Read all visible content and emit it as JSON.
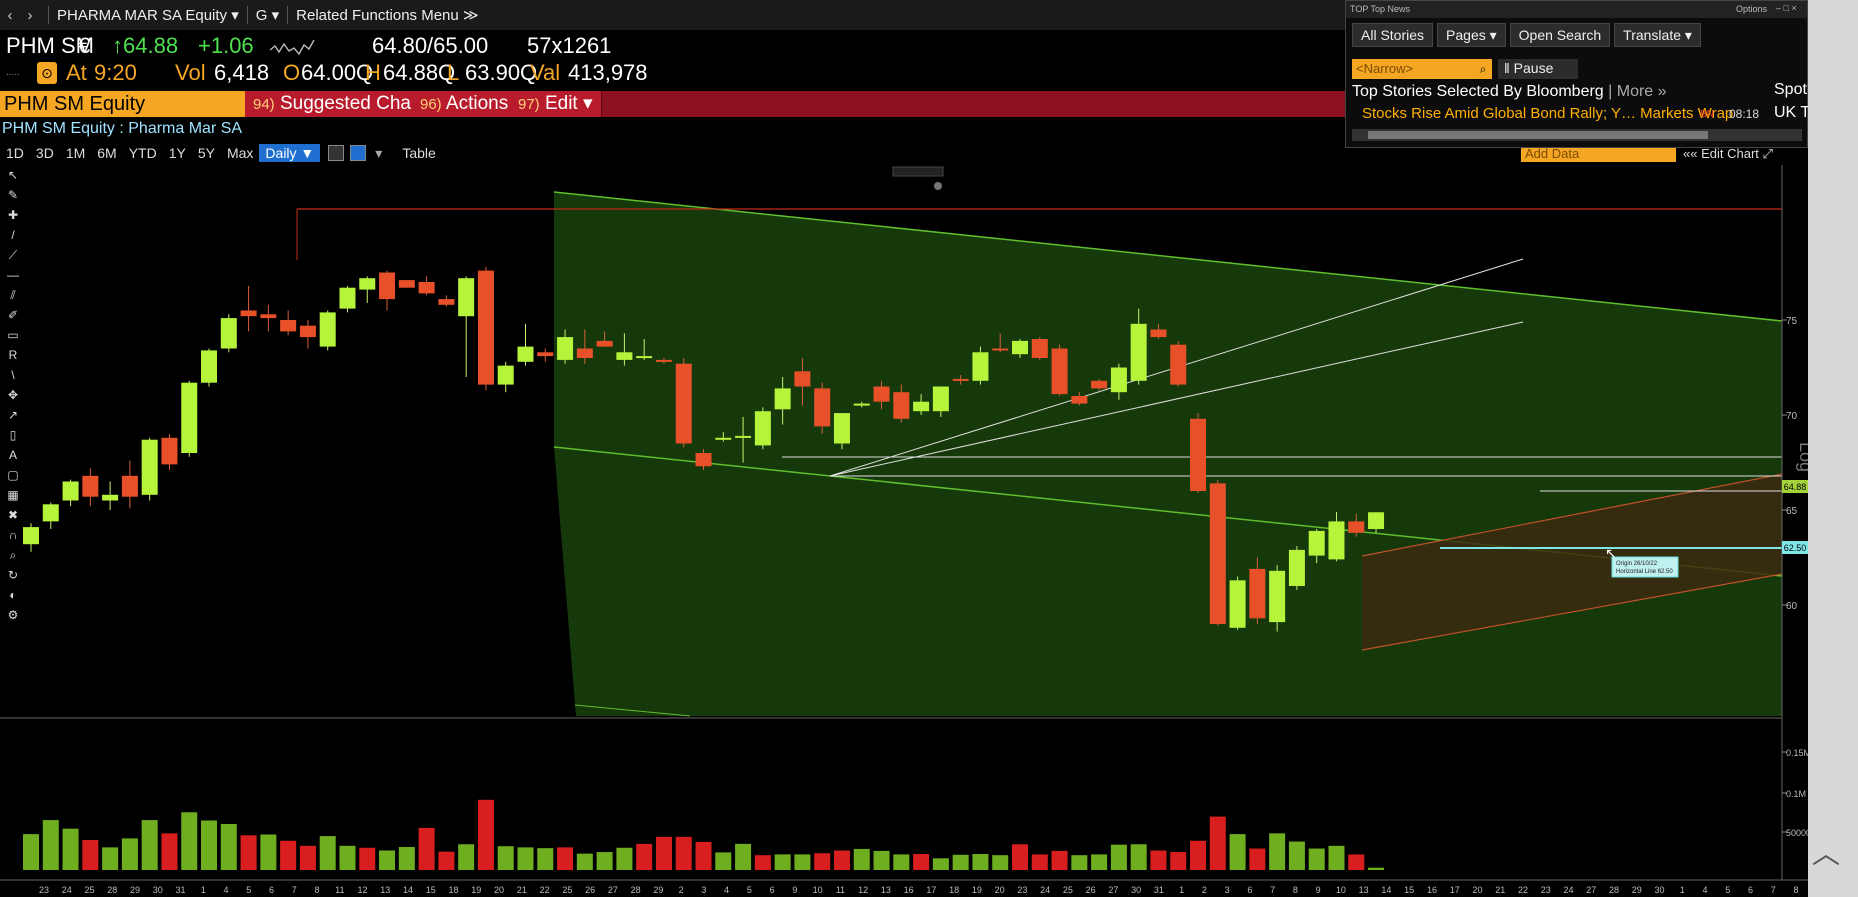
{
  "menu": {
    "back": "‹",
    "forward": "›",
    "security": "PHARMA MAR SA Equity ▾",
    "g": "G ▾",
    "related": "Related Functions Menu ≫"
  },
  "quote": {
    "ticker": "PHM SM",
    "currency": "€",
    "last": "↑64.88",
    "change": "+1.06",
    "bidask": "64.80/65.00",
    "size": "57x1261",
    "at_label": "At",
    "time": "9:20",
    "vol_label": "Vol",
    "vol": "6,418",
    "open_label": "O",
    "open": "64.00Q",
    "high_label": "H",
    "high": "64.88Q",
    "low_label": "L",
    "low": "63.90Q",
    "val_label": "Val",
    "val": "413,978"
  },
  "commandbar": {
    "ticker": "PHM SM Equity",
    "suggested_num": "94)",
    "suggested": "Suggested Charts ▾",
    "actions_num": "96)",
    "actions": "Actions ▾",
    "edit_num": "97)",
    "edit": "Edit ▾"
  },
  "subtitle": "PHM SM Equity : Pharma Mar SA",
  "periods": [
    "1D",
    "3D",
    "1M",
    "6M",
    "YTD",
    "1Y",
    "5Y",
    "Max"
  ],
  "daily": "Daily ▼",
  "table": "Table",
  "add_data": "Add Data",
  "edit_chart": "Edit Chart",
  "news": {
    "titlebar": "TOP Top News",
    "options": "Options",
    "tabs": [
      "All Stories",
      "Pages ▾",
      "Open Search",
      "Translate ▾"
    ],
    "search_placeholder": "<Narrow>",
    "pause": "‖ Pause",
    "heading": "Top Stories Selected By Bloomberg",
    "more": "| More »",
    "story": "Stocks Rise Amid Global Bond Rally; Y… Markets Wrap",
    "source": "BN",
    "time": "08:18",
    "side1": "Spotl",
    "side2": "UK T"
  },
  "chart_data": {
    "type": "candlestick",
    "ylabel": "Log",
    "price_ticks": [
      60,
      65,
      70,
      75
    ],
    "volume_ticks": [
      "50000",
      "0.1M",
      "0.15M"
    ],
    "last_price_label": "64.88",
    "line_price_label": "62.50",
    "annotation": [
      "Origin 26/10/22",
      "Horizontal Line 62.50"
    ],
    "x_labels": [
      "23",
      "24",
      "25",
      "28",
      "29",
      "30",
      "31",
      "1",
      "4",
      "5",
      "6",
      "7",
      "8",
      "11",
      "12",
      "13",
      "14",
      "15",
      "18",
      "19",
      "20",
      "21",
      "22",
      "25",
      "26",
      "27",
      "28",
      "29",
      "2",
      "3",
      "4",
      "5",
      "6",
      "9",
      "10",
      "11",
      "12",
      "13",
      "16",
      "17",
      "18",
      "19",
      "20",
      "23",
      "24",
      "25",
      "26",
      "27",
      "30",
      "31",
      "1",
      "2",
      "3",
      "6",
      "7",
      "8",
      "9",
      "10",
      "13",
      "14",
      "15",
      "16",
      "17",
      "20",
      "21",
      "22",
      "23",
      "24",
      "27",
      "28",
      "29",
      "30",
      "1",
      "4",
      "5",
      "6",
      "7",
      "8"
    ],
    "colors": {
      "up": "#b5f43a",
      "down": "#e8502a",
      "vol_up": "#6fae1f",
      "vol_down": "#d81e1e",
      "channel": "#1f4a0f"
    },
    "candles": [
      {
        "o": 63.2,
        "h": 64.3,
        "l": 62.8,
        "c": 64.1
      },
      {
        "o": 64.4,
        "h": 65.4,
        "l": 64.0,
        "c": 65.3
      },
      {
        "o": 65.5,
        "h": 66.6,
        "l": 65.2,
        "c": 66.5
      },
      {
        "o": 66.8,
        "h": 67.2,
        "l": 65.2,
        "c": 65.7
      },
      {
        "o": 65.5,
        "h": 66.5,
        "l": 65.0,
        "c": 65.8
      },
      {
        "o": 66.8,
        "h": 67.6,
        "l": 65.1,
        "c": 65.7
      },
      {
        "o": 65.8,
        "h": 68.8,
        "l": 65.5,
        "c": 68.7
      },
      {
        "o": 68.8,
        "h": 69.0,
        "l": 67.1,
        "c": 67.4
      },
      {
        "o": 68.0,
        "h": 71.8,
        "l": 67.8,
        "c": 71.7
      },
      {
        "o": 71.7,
        "h": 73.5,
        "l": 71.5,
        "c": 73.4
      },
      {
        "o": 73.5,
        "h": 75.3,
        "l": 73.3,
        "c": 75.1
      },
      {
        "o": 75.5,
        "h": 76.8,
        "l": 74.4,
        "c": 75.2
      },
      {
        "o": 75.3,
        "h": 75.8,
        "l": 74.4,
        "c": 75.1
      },
      {
        "o": 75.0,
        "h": 75.5,
        "l": 74.2,
        "c": 74.4
      },
      {
        "o": 74.7,
        "h": 75.0,
        "l": 73.5,
        "c": 74.1
      },
      {
        "o": 73.6,
        "h": 75.5,
        "l": 73.4,
        "c": 75.4
      },
      {
        "o": 75.6,
        "h": 76.8,
        "l": 75.4,
        "c": 76.7
      },
      {
        "o": 76.6,
        "h": 77.3,
        "l": 75.9,
        "c": 77.2
      },
      {
        "o": 77.5,
        "h": 77.6,
        "l": 75.5,
        "c": 76.1
      },
      {
        "o": 77.1,
        "h": 77.1,
        "l": 76.7,
        "c": 76.7
      },
      {
        "o": 77.0,
        "h": 77.3,
        "l": 76.3,
        "c": 76.4
      },
      {
        "o": 76.1,
        "h": 76.3,
        "l": 75.7,
        "c": 75.8
      },
      {
        "o": 75.2,
        "h": 77.3,
        "l": 72.0,
        "c": 77.2
      },
      {
        "o": 77.6,
        "h": 77.8,
        "l": 71.3,
        "c": 71.6
      },
      {
        "o": 71.6,
        "h": 72.8,
        "l": 71.2,
        "c": 72.6
      },
      {
        "o": 72.8,
        "h": 74.8,
        "l": 72.6,
        "c": 73.6
      },
      {
        "o": 73.3,
        "h": 73.5,
        "l": 72.8,
        "c": 73.1
      },
      {
        "o": 72.9,
        "h": 74.5,
        "l": 72.7,
        "c": 74.1
      },
      {
        "o": 73.5,
        "h": 74.5,
        "l": 72.7,
        "c": 73.0
      },
      {
        "o": 73.9,
        "h": 74.4,
        "l": 73.6,
        "c": 73.6
      },
      {
        "o": 72.9,
        "h": 74.3,
        "l": 72.6,
        "c": 73.3
      },
      {
        "o": 73.1,
        "h": 74.0,
        "l": 72.9,
        "c": 73.1
      },
      {
        "o": 72.9,
        "h": 73.0,
        "l": 72.7,
        "c": 72.8
      },
      {
        "o": 72.7,
        "h": 73.0,
        "l": 68.3,
        "c": 68.5
      },
      {
        "o": 68.0,
        "h": 68.2,
        "l": 67.1,
        "c": 67.3
      },
      {
        "o": 68.8,
        "h": 69.1,
        "l": 68.6,
        "c": 68.8
      },
      {
        "o": 68.9,
        "h": 69.9,
        "l": 67.5,
        "c": 68.9
      },
      {
        "o": 68.4,
        "h": 70.4,
        "l": 68.2,
        "c": 70.2
      },
      {
        "o": 70.3,
        "h": 72.0,
        "l": 69.5,
        "c": 71.4
      },
      {
        "o": 72.3,
        "h": 73.0,
        "l": 70.5,
        "c": 71.5
      },
      {
        "o": 71.4,
        "h": 71.7,
        "l": 69.0,
        "c": 69.4
      },
      {
        "o": 68.5,
        "h": 70.1,
        "l": 68.2,
        "c": 70.1
      },
      {
        "o": 70.6,
        "h": 70.7,
        "l": 70.4,
        "c": 70.6
      },
      {
        "o": 71.5,
        "h": 71.8,
        "l": 70.3,
        "c": 70.7
      },
      {
        "o": 71.2,
        "h": 71.6,
        "l": 69.6,
        "c": 69.8
      },
      {
        "o": 70.2,
        "h": 71.1,
        "l": 70.0,
        "c": 70.7
      },
      {
        "o": 70.2,
        "h": 71.5,
        "l": 69.9,
        "c": 71.5
      },
      {
        "o": 71.9,
        "h": 72.1,
        "l": 71.6,
        "c": 71.8
      },
      {
        "o": 71.8,
        "h": 73.6,
        "l": 71.6,
        "c": 73.3
      },
      {
        "o": 73.5,
        "h": 74.3,
        "l": 73.3,
        "c": 73.4
      },
      {
        "o": 73.2,
        "h": 74.0,
        "l": 73.0,
        "c": 73.9
      },
      {
        "o": 74.0,
        "h": 74.1,
        "l": 72.9,
        "c": 73.0
      },
      {
        "o": 73.5,
        "h": 73.7,
        "l": 71.0,
        "c": 71.1
      },
      {
        "o": 71.0,
        "h": 71.2,
        "l": 70.5,
        "c": 70.6
      },
      {
        "o": 71.8,
        "h": 71.9,
        "l": 71.3,
        "c": 71.4
      },
      {
        "o": 71.2,
        "h": 72.7,
        "l": 70.8,
        "c": 72.5
      },
      {
        "o": 71.8,
        "h": 75.6,
        "l": 71.6,
        "c": 74.8
      },
      {
        "o": 74.5,
        "h": 74.8,
        "l": 74.0,
        "c": 74.1
      },
      {
        "o": 73.7,
        "h": 73.9,
        "l": 71.5,
        "c": 71.6
      },
      {
        "o": 69.8,
        "h": 70.1,
        "l": 65.9,
        "c": 66.0
      },
      {
        "o": 66.4,
        "h": 66.6,
        "l": 58.9,
        "c": 59.0
      },
      {
        "o": 58.8,
        "h": 61.5,
        "l": 58.7,
        "c": 61.3
      },
      {
        "o": 61.9,
        "h": 62.5,
        "l": 59.0,
        "c": 59.3
      },
      {
        "o": 59.1,
        "h": 62.1,
        "l": 58.6,
        "c": 61.8
      },
      {
        "o": 61.0,
        "h": 63.1,
        "l": 60.8,
        "c": 62.9
      },
      {
        "o": 62.6,
        "h": 64.0,
        "l": 62.2,
        "c": 63.9
      },
      {
        "o": 62.4,
        "h": 64.9,
        "l": 62.3,
        "c": 64.4
      },
      {
        "o": 64.4,
        "h": 64.8,
        "l": 63.6,
        "c": 63.8
      },
      {
        "o": 64.0,
        "h": 64.9,
        "l": 63.8,
        "c": 64.88
      }
    ],
    "volume": [
      {
        "v": 0.092,
        "up": true
      },
      {
        "v": 0.128,
        "up": true
      },
      {
        "v": 0.106,
        "up": true
      },
      {
        "v": 0.077,
        "up": false
      },
      {
        "v": 0.058,
        "up": true
      },
      {
        "v": 0.081,
        "up": true
      },
      {
        "v": 0.128,
        "up": true
      },
      {
        "v": 0.094,
        "up": false
      },
      {
        "v": 0.148,
        "up": true
      },
      {
        "v": 0.127,
        "up": true
      },
      {
        "v": 0.118,
        "up": true
      },
      {
        "v": 0.089,
        "up": false
      },
      {
        "v": 0.091,
        "up": true
      },
      {
        "v": 0.075,
        "up": false
      },
      {
        "v": 0.062,
        "up": false
      },
      {
        "v": 0.087,
        "up": true
      },
      {
        "v": 0.062,
        "up": true
      },
      {
        "v": 0.057,
        "up": false
      },
      {
        "v": 0.05,
        "up": true
      },
      {
        "v": 0.059,
        "up": true
      },
      {
        "v": 0.108,
        "up": false
      },
      {
        "v": 0.047,
        "up": false
      },
      {
        "v": 0.066,
        "up": true
      },
      {
        "v": 0.18,
        "up": false
      },
      {
        "v": 0.061,
        "up": true
      },
      {
        "v": 0.058,
        "up": true
      },
      {
        "v": 0.056,
        "up": true
      },
      {
        "v": 0.058,
        "up": false
      },
      {
        "v": 0.042,
        "up": true
      },
      {
        "v": 0.046,
        "up": true
      },
      {
        "v": 0.057,
        "up": true
      },
      {
        "v": 0.067,
        "up": false
      },
      {
        "v": 0.085,
        "up": false
      },
      {
        "v": 0.085,
        "up": false
      },
      {
        "v": 0.072,
        "up": false
      },
      {
        "v": 0.045,
        "up": true
      },
      {
        "v": 0.067,
        "up": true
      },
      {
        "v": 0.038,
        "up": false
      },
      {
        "v": 0.04,
        "up": true
      },
      {
        "v": 0.04,
        "up": true
      },
      {
        "v": 0.043,
        "up": false
      },
      {
        "v": 0.05,
        "up": false
      },
      {
        "v": 0.054,
        "up": true
      },
      {
        "v": 0.049,
        "up": true
      },
      {
        "v": 0.04,
        "up": true
      },
      {
        "v": 0.041,
        "up": false
      },
      {
        "v": 0.03,
        "up": true
      },
      {
        "v": 0.039,
        "up": true
      },
      {
        "v": 0.041,
        "up": true
      },
      {
        "v": 0.038,
        "up": true
      },
      {
        "v": 0.066,
        "up": false
      },
      {
        "v": 0.04,
        "up": false
      },
      {
        "v": 0.049,
        "up": false
      },
      {
        "v": 0.038,
        "up": true
      },
      {
        "v": 0.04,
        "up": true
      },
      {
        "v": 0.065,
        "up": true
      },
      {
        "v": 0.066,
        "up": true
      },
      {
        "v": 0.05,
        "up": false
      },
      {
        "v": 0.046,
        "up": false
      },
      {
        "v": 0.075,
        "up": false
      },
      {
        "v": 0.137,
        "up": false
      },
      {
        "v": 0.092,
        "up": true
      },
      {
        "v": 0.055,
        "up": false
      },
      {
        "v": 0.094,
        "up": true
      },
      {
        "v": 0.073,
        "up": true
      },
      {
        "v": 0.055,
        "up": true
      },
      {
        "v": 0.062,
        "up": true
      },
      {
        "v": 0.04,
        "up": false
      },
      {
        "v": 0.006,
        "up": true
      }
    ]
  }
}
